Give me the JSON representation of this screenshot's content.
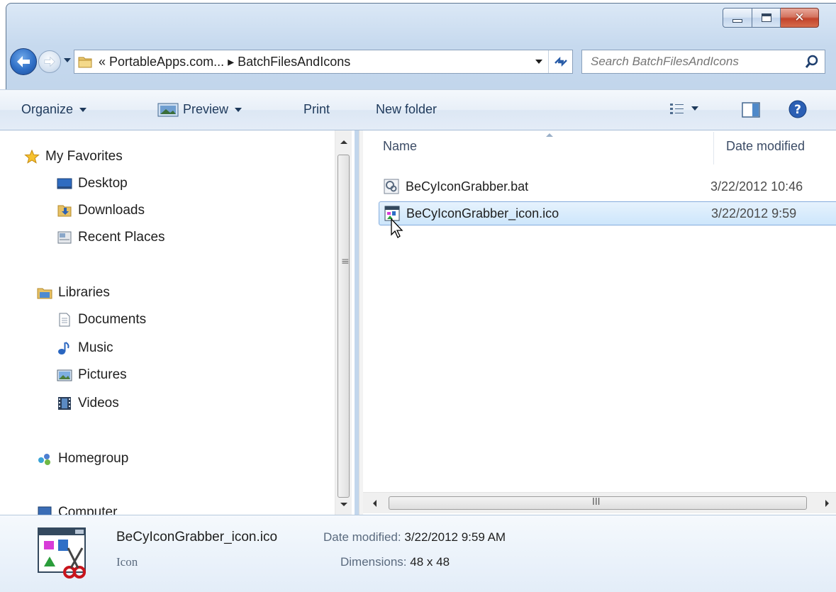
{
  "window": {
    "minimize_label": "minimize",
    "maximize_label": "maximize",
    "close_label": "✕"
  },
  "address_bar": {
    "path_text": "« PortableApps.com... ▸ BatchFilesAndIcons",
    "breadcrumb": [
      "PortableApps.com...",
      "BatchFilesAndIcons"
    ]
  },
  "search": {
    "placeholder": "Search BatchFilesAndIcons"
  },
  "toolbar": {
    "organize": "Organize",
    "preview": "Preview",
    "print": "Print",
    "new_folder": "New folder"
  },
  "nav": {
    "favorites_header": "My Favorites",
    "favorites": [
      "Desktop",
      "Downloads",
      "Recent Places"
    ],
    "libraries_header": "Libraries",
    "libraries": [
      "Documents",
      "Music",
      "Pictures",
      "Videos"
    ],
    "homegroup": "Homegroup",
    "computer": "Computer"
  },
  "columns": {
    "name": "Name",
    "date_modified": "Date modified"
  },
  "files": [
    {
      "name": "BeCyIconGrabber.bat",
      "date": "3/22/2012 10:46",
      "icon": "batch-file-icon",
      "selected": false
    },
    {
      "name": "BeCyIconGrabber_icon.ico",
      "date": "3/22/2012 9:59",
      "icon": "ico-file-icon",
      "selected": true
    }
  ],
  "details": {
    "name": "BeCyIconGrabber_icon.ico",
    "type": "Icon",
    "date_label": "Date modified:",
    "date_value": "3/22/2012 9:59 AM",
    "dimensions_label": "Dimensions:",
    "dimensions_value": "48 x 48"
  },
  "colors": {
    "selection_bg": "#cde6fb",
    "selection_border": "#84acdd",
    "command_bar": "#e8eff8",
    "window_chrome": "#c6d9ee"
  },
  "scrollbars": {
    "h_grip": "III",
    "v_grip": "≡"
  }
}
